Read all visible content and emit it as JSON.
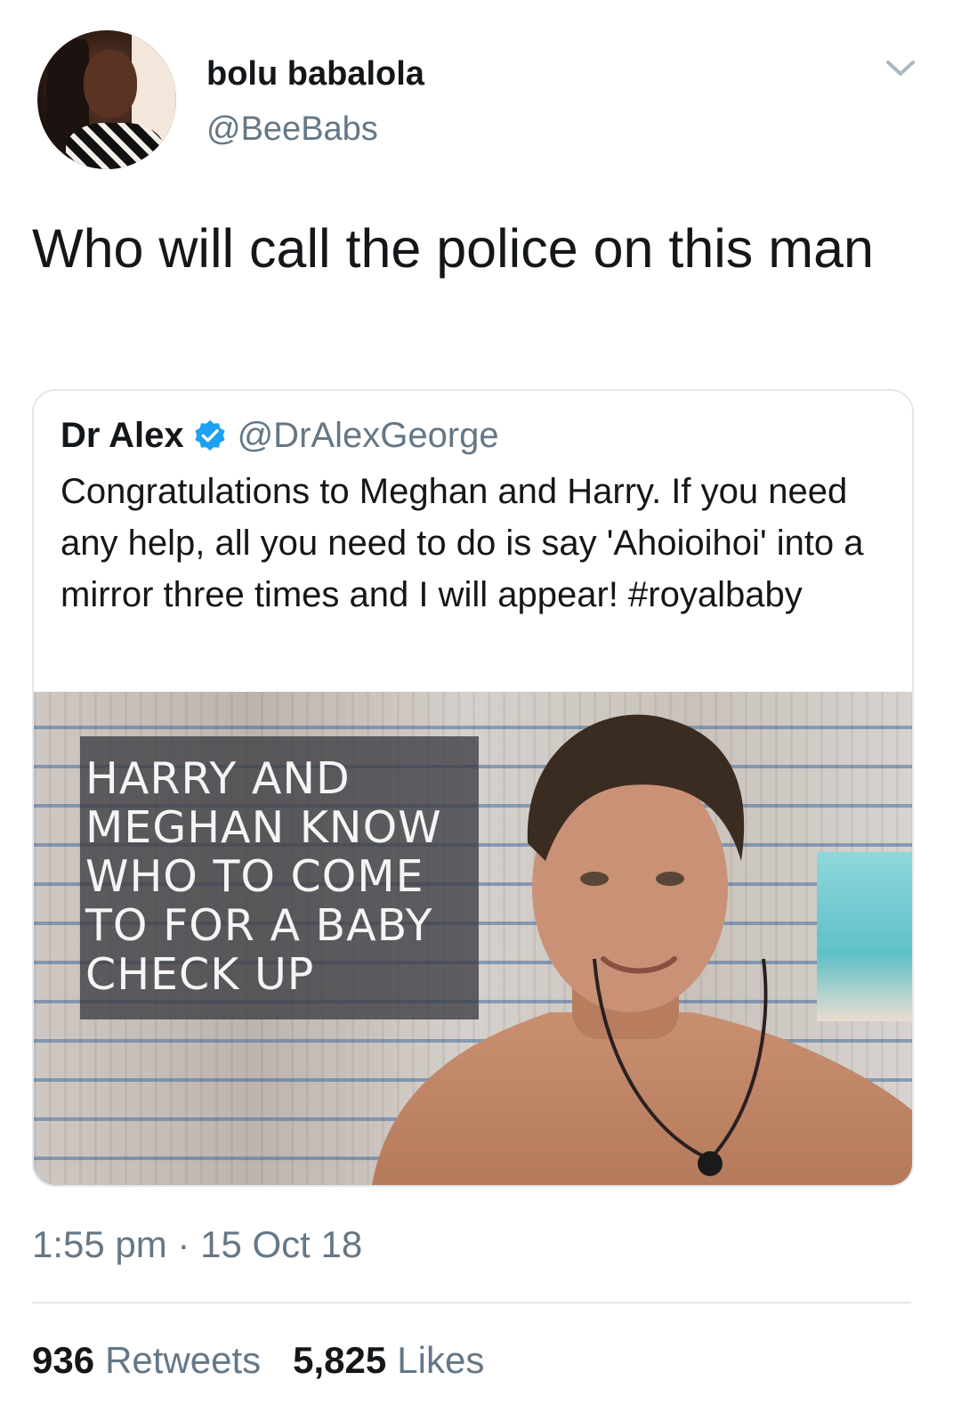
{
  "author": {
    "name": "bolu babalola",
    "handle": "@BeeBabs"
  },
  "tweet": {
    "text": "Who will call the police on this man"
  },
  "quoted": {
    "name": "Dr Alex",
    "verified": true,
    "handle": "@DrAlexGeorge",
    "text": "Congratulations to Meghan and Harry. If you need any help, all you need to do is say 'Ahoioihoi' into a mirror three times and I will appear! #royalbaby",
    "image_caption": "HARRY AND\nMEGHAN KNOW\nWHO TO COME\nTO FOR A BABY\nCHECK UP"
  },
  "meta": {
    "timestamp": "1:55 pm · 15 Oct 18",
    "retweets_count": "936",
    "retweets_label": "Retweets",
    "likes_count": "5,825",
    "likes_label": "Likes"
  },
  "icons": {
    "menu": "chevron-down-icon",
    "verified": "verified-badge-icon"
  },
  "colors": {
    "text_primary": "#14171a",
    "text_secondary": "#657786",
    "verified_blue": "#1da1f2",
    "border": "#e1e8ed"
  }
}
